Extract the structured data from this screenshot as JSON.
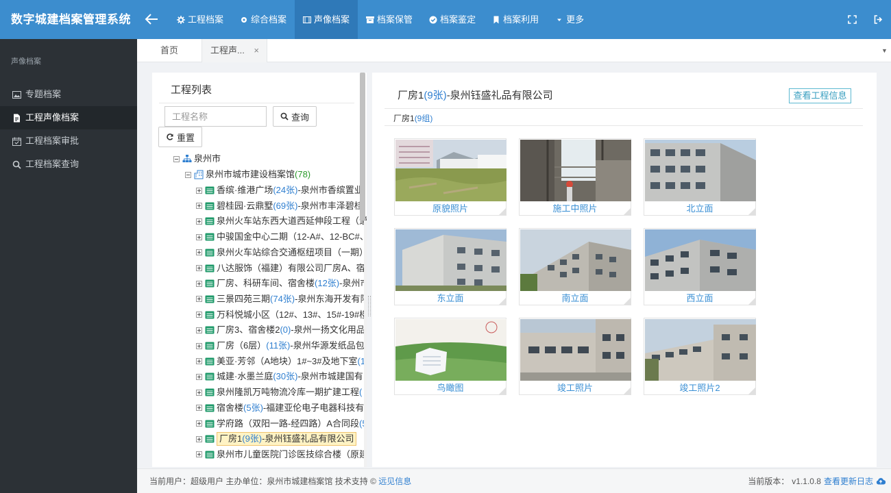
{
  "app": {
    "title": "数字城建档案管理系统"
  },
  "nav": {
    "items": [
      {
        "label": "工程档案",
        "icon": "gear-icon"
      },
      {
        "label": "综合档案",
        "icon": "cog-icon"
      },
      {
        "label": "声像档案",
        "icon": "film-icon",
        "active": true
      },
      {
        "label": "档案保管",
        "icon": "archive-icon"
      },
      {
        "label": "档案鉴定",
        "icon": "check-circle-icon"
      },
      {
        "label": "档案利用",
        "icon": "bookmark-icon"
      },
      {
        "label": "更多",
        "icon": "caret-down-icon"
      }
    ]
  },
  "sidebar": {
    "header": "声像档案",
    "items": [
      {
        "label": "专题档案",
        "icon": "image-icon"
      },
      {
        "label": "工程声像档案",
        "icon": "document-icon",
        "active": true
      },
      {
        "label": "工程档案审批",
        "icon": "calendar-check-icon"
      },
      {
        "label": "工程档案查询",
        "icon": "search-icon"
      }
    ]
  },
  "tabs": {
    "home": "首页",
    "current": "工程声...",
    "close": "×"
  },
  "left_panel": {
    "title": "工程列表",
    "search_placeholder": "工程名称",
    "query_label": "查询",
    "reset_label": "重置",
    "tree": {
      "root": "泉州市",
      "org": {
        "name": "泉州市城市建设档案馆",
        "count": "(78)"
      },
      "projects": [
        {
          "a": "香缤·维港广场",
          "c": "(24张)",
          "b": "-泉州市香缤置业"
        },
        {
          "a": "碧桂园·云鼎墅",
          "c": "(69张)",
          "b": "-泉州市丰泽碧桂"
        },
        {
          "a": "泉州火车站东西大道西延伸段工程（道",
          "c": "",
          "b": ""
        },
        {
          "a": "中骏国金中心二期（12-A#、12-BC#、",
          "c": "",
          "b": ""
        },
        {
          "a": "泉州火车站综合交通枢纽项目（一期）",
          "c": "",
          "b": ""
        },
        {
          "a": "八达服饰（福建）有限公司厂房A、宿",
          "c": "",
          "b": ""
        },
        {
          "a": "厂房、科研车间、宿舍楼",
          "c": "(12张)",
          "b": "-泉州市"
        },
        {
          "a": "三景四苑三期",
          "c": "(74张)",
          "b": "-泉州东海开发有限"
        },
        {
          "a": "万科悦城小区（12#、13#、15#-19#楼",
          "c": "",
          "b": ""
        },
        {
          "a": "厂房3、宿舍楼2",
          "c": "(0)",
          "b": "-泉州一扬文化用品"
        },
        {
          "a": "厂房（6层）",
          "c": "(11张)",
          "b": "-泉州华源发纸品包"
        },
        {
          "a": "美亚·芳邻（A地块）1#~3#及地下室",
          "c": "(1",
          "b": ""
        },
        {
          "a": "城建·水墨兰庭",
          "c": "(30张)",
          "b": "-泉州市城建国有"
        },
        {
          "a": "泉州隆凯万吨物流冷库一期扩建工程",
          "c": "(",
          "b": ""
        },
        {
          "a": "宿舍楼",
          "c": "(5张)",
          "b": "-福建亚伦电子电器科技有"
        },
        {
          "a": "学府路（双阳一路-经四路）A合同段",
          "c": "(5",
          "b": ""
        },
        {
          "a": "厂房1",
          "c": "(9张)",
          "b": "-泉州钰盛礼品有限公司",
          "selected": true
        },
        {
          "a": "泉州市儿童医院门诊医技综合楼（原建",
          "c": "",
          "b": ""
        }
      ]
    }
  },
  "right_panel": {
    "title_name": "厂房1",
    "title_count": "(9张)",
    "title_company": "-泉州钰盛礼品有限公司",
    "info_button": "查看工程信息",
    "group_name": "厂房1",
    "group_count": "(9组)",
    "photos": [
      {
        "caption": "原貌照片"
      },
      {
        "caption": "施工中照片"
      },
      {
        "caption": "北立面"
      },
      {
        "caption": "东立面"
      },
      {
        "caption": "南立面"
      },
      {
        "caption": "西立面"
      },
      {
        "caption": "鸟瞰图"
      },
      {
        "caption": "竣工照片"
      },
      {
        "caption": "竣工照片2"
      }
    ]
  },
  "footer": {
    "user_label": "当前用户：",
    "user": "超级用户",
    "unit_label": "主办单位：",
    "unit": "泉州市城建档案馆",
    "support_label": "技术支持 ©",
    "support": "远见信息",
    "version_label": "当前版本：",
    "version": "v1.1.0.8",
    "update_log": "查看更新日志"
  },
  "colors": {
    "topbar": "#3c8dce",
    "sidebar": "#2c3136",
    "link": "#2f7fd0",
    "count_green": "#2a9a2a"
  }
}
